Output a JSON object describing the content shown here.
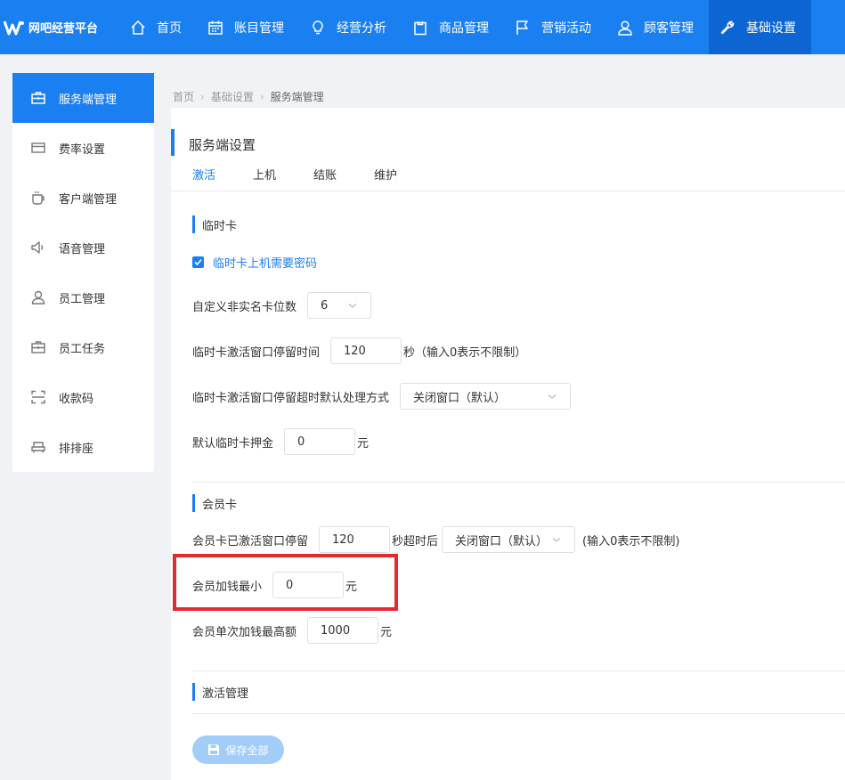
{
  "brand": {
    "text": "网吧经营平台",
    "logo_icon": "wave-logo-icon"
  },
  "topnav": {
    "items": [
      {
        "label": "首页",
        "icon": "home-icon"
      },
      {
        "label": "账目管理",
        "icon": "calendar-icon"
      },
      {
        "label": "经营分析",
        "icon": "lightbulb-icon"
      },
      {
        "label": "商品管理",
        "icon": "clipboard-icon"
      },
      {
        "label": "营销活动",
        "icon": "flag-icon"
      },
      {
        "label": "顾客管理",
        "icon": "user-icon"
      },
      {
        "label": "基础设置",
        "icon": "wrench-icon",
        "active": true
      }
    ]
  },
  "sidebar": {
    "items": [
      {
        "label": "服务端管理",
        "icon": "briefcase-icon",
        "active": true
      },
      {
        "label": "费率设置",
        "icon": "card-icon"
      },
      {
        "label": "客户端管理",
        "icon": "cup-icon"
      },
      {
        "label": "语音管理",
        "icon": "speaker-icon"
      },
      {
        "label": "员工管理",
        "icon": "person-icon"
      },
      {
        "label": "员工任务",
        "icon": "task-icon"
      },
      {
        "label": "收款码",
        "icon": "scan-icon"
      },
      {
        "label": "排排座",
        "icon": "seat-icon"
      }
    ]
  },
  "breadcrumb": {
    "items": [
      "首页",
      "基础设置",
      "服务端管理"
    ]
  },
  "panel": {
    "title": "服务端设置",
    "tabs": [
      "激活",
      "上机",
      "结账",
      "维护"
    ],
    "temp_card": {
      "heading": "临时卡",
      "require_password_label": "临时卡上机需要密码",
      "require_password_checked": true,
      "digits_label": "自定义非实名卡位数",
      "digits_value": "6",
      "window_time_label": "临时卡激活窗口停留时间",
      "window_time_value": "120",
      "window_time_unit": "秒（输入0表示不限制）",
      "timeout_action_label": "临时卡激活窗口停留超时默认处理方式",
      "timeout_action_value": "关闭窗口（默认）",
      "deposit_label": "默认临时卡押金",
      "deposit_value": "0",
      "deposit_unit": "元"
    },
    "member_card": {
      "heading": "会员卡",
      "window_label": "会员卡已激活窗口停留",
      "window_value": "120",
      "window_unit": "秒超时后",
      "window_action_value": "关闭窗口（默认）",
      "window_note": "(输入0表示不限制)",
      "min_add_label": "会员加钱最小",
      "min_add_value": "0",
      "min_add_unit": "元",
      "max_add_label": "会员单次加钱最高额",
      "max_add_value": "1000",
      "max_add_unit": "元"
    },
    "activation": {
      "heading": "激活管理"
    },
    "save_label": "保存全部"
  },
  "colors": {
    "primary": "#1a7ff0",
    "highlight": "#e8282f",
    "save_disabled": "#a3cdf9"
  }
}
